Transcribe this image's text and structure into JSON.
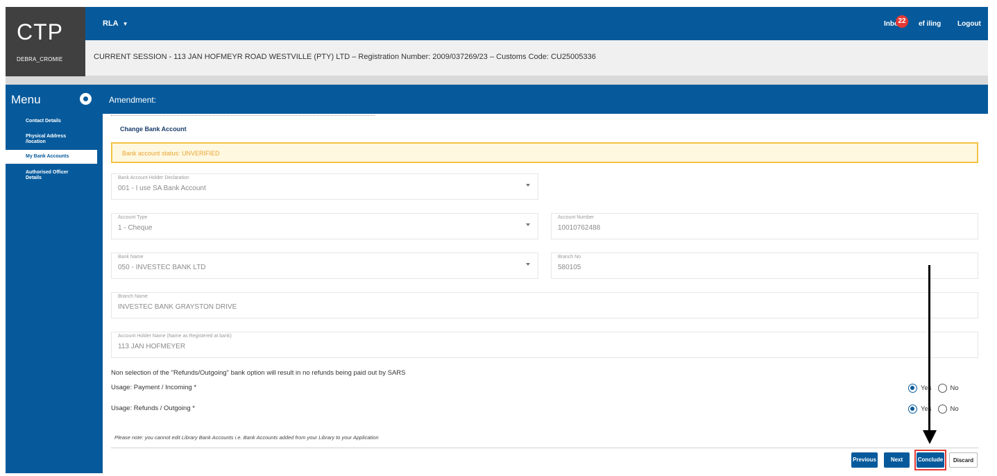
{
  "brand": {
    "logo": "CTP",
    "username": "DEBRA_CROMIE"
  },
  "header": {
    "role": "RLA",
    "inbox_label": "Inbo",
    "inbox_count": "22",
    "efiling": "ef iling",
    "logout": "Logout"
  },
  "session": {
    "text": "CURRENT SESSION - 113 JAN HOFMEYR ROAD WESTVILLE (PTY) LTD – Registration Number: 2009/037269/23 – Customs Code: CU25005336"
  },
  "menu": {
    "title": "Menu"
  },
  "page": {
    "title": "Amendment:"
  },
  "sidebar": {
    "items": [
      {
        "label": "Contact Details"
      },
      {
        "label": "Physical Address /location"
      },
      {
        "label": "My Bank Accounts"
      },
      {
        "label": "Authorised Officer Details"
      }
    ]
  },
  "form": {
    "section_title": "Change Bank Account",
    "alert": "Bank account status: UNVERIFIED",
    "holder_declaration": {
      "label": "Bank Account Holder Declaration",
      "value": "001 - I use SA Bank Account"
    },
    "account_type": {
      "label": "Account Type",
      "value": "1 - Cheque"
    },
    "account_number": {
      "label": "Account Number",
      "value": "10010762488"
    },
    "bank_name": {
      "label": "Bank Name",
      "value": "050 - INVESTEC BANK LTD"
    },
    "branch_no": {
      "label": "Branch No",
      "value": "580105"
    },
    "branch_name": {
      "label": "Branch Name",
      "value": "INVESTEC BANK GRAYSTON DRIVE"
    },
    "holder_name": {
      "label": "Account Holder Name (Name as Registered at bank)",
      "value": "113 JAN HOFMEYER"
    },
    "notice": "Non selection of the \"Refunds/Outgoing\" bank option will result in no refunds being paid out by SARS",
    "usage_payment": {
      "label": "Usage: Payment / Incoming *",
      "yes": "Yes",
      "no": "No",
      "selected": "Yes"
    },
    "usage_refunds": {
      "label": "Usage: Refunds / Outgoing *",
      "yes": "Yes",
      "no": "No",
      "selected": "Yes"
    },
    "note": "Please note: you cannot edit Library Bank Accounts i.e. Bank Accounts added from your Library to your Application"
  },
  "buttons": {
    "previous": "Previous",
    "next": "Next",
    "conclude": "Conclude",
    "discard": "Discard"
  },
  "colors": {
    "primary": "#065a9c",
    "alert_border": "#f4c242",
    "alert_text": "#e8a530",
    "badge": "#e53935",
    "highlight": "#e53935"
  },
  "icons": [
    "caret-down-icon",
    "menu-toggle-icon",
    "dropdown-arrow-icon",
    "annotation-arrow-icon"
  ]
}
